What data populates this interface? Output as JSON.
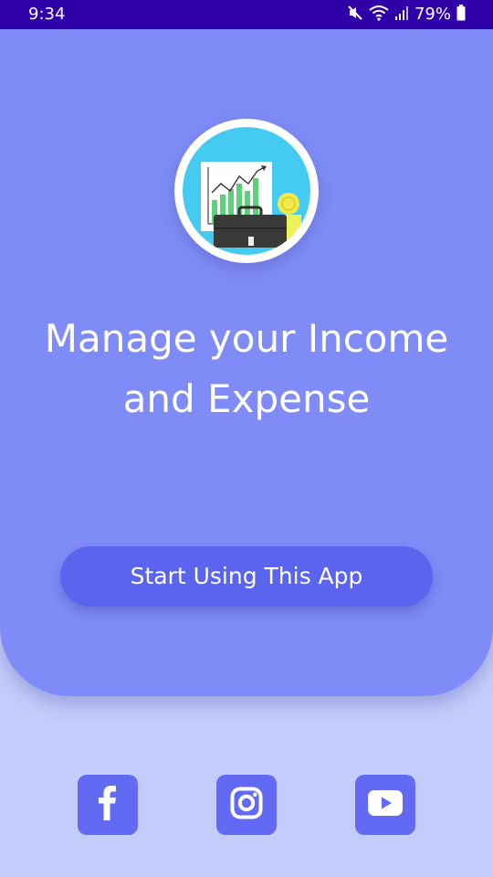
{
  "status_bar": {
    "time": "9:34",
    "battery": "79%",
    "icons": [
      "mute-icon",
      "wifi-icon",
      "signal-icon",
      "battery-icon"
    ],
    "background": "#2f00a8"
  },
  "hero": {
    "headline_line1": "Manage your Income",
    "headline_line2": "and Expense",
    "logo_icon": "finance-briefcase-chart-logo",
    "background": "#7f8bf7"
  },
  "cta": {
    "label": "Start Using This App",
    "background": "#5b64ee"
  },
  "social": {
    "items": [
      {
        "name": "facebook",
        "icon": "facebook-icon"
      },
      {
        "name": "instagram",
        "icon": "instagram-icon"
      },
      {
        "name": "youtube",
        "icon": "youtube-icon"
      }
    ],
    "background": "#6269f2"
  },
  "page_background": "#c4ccfb"
}
